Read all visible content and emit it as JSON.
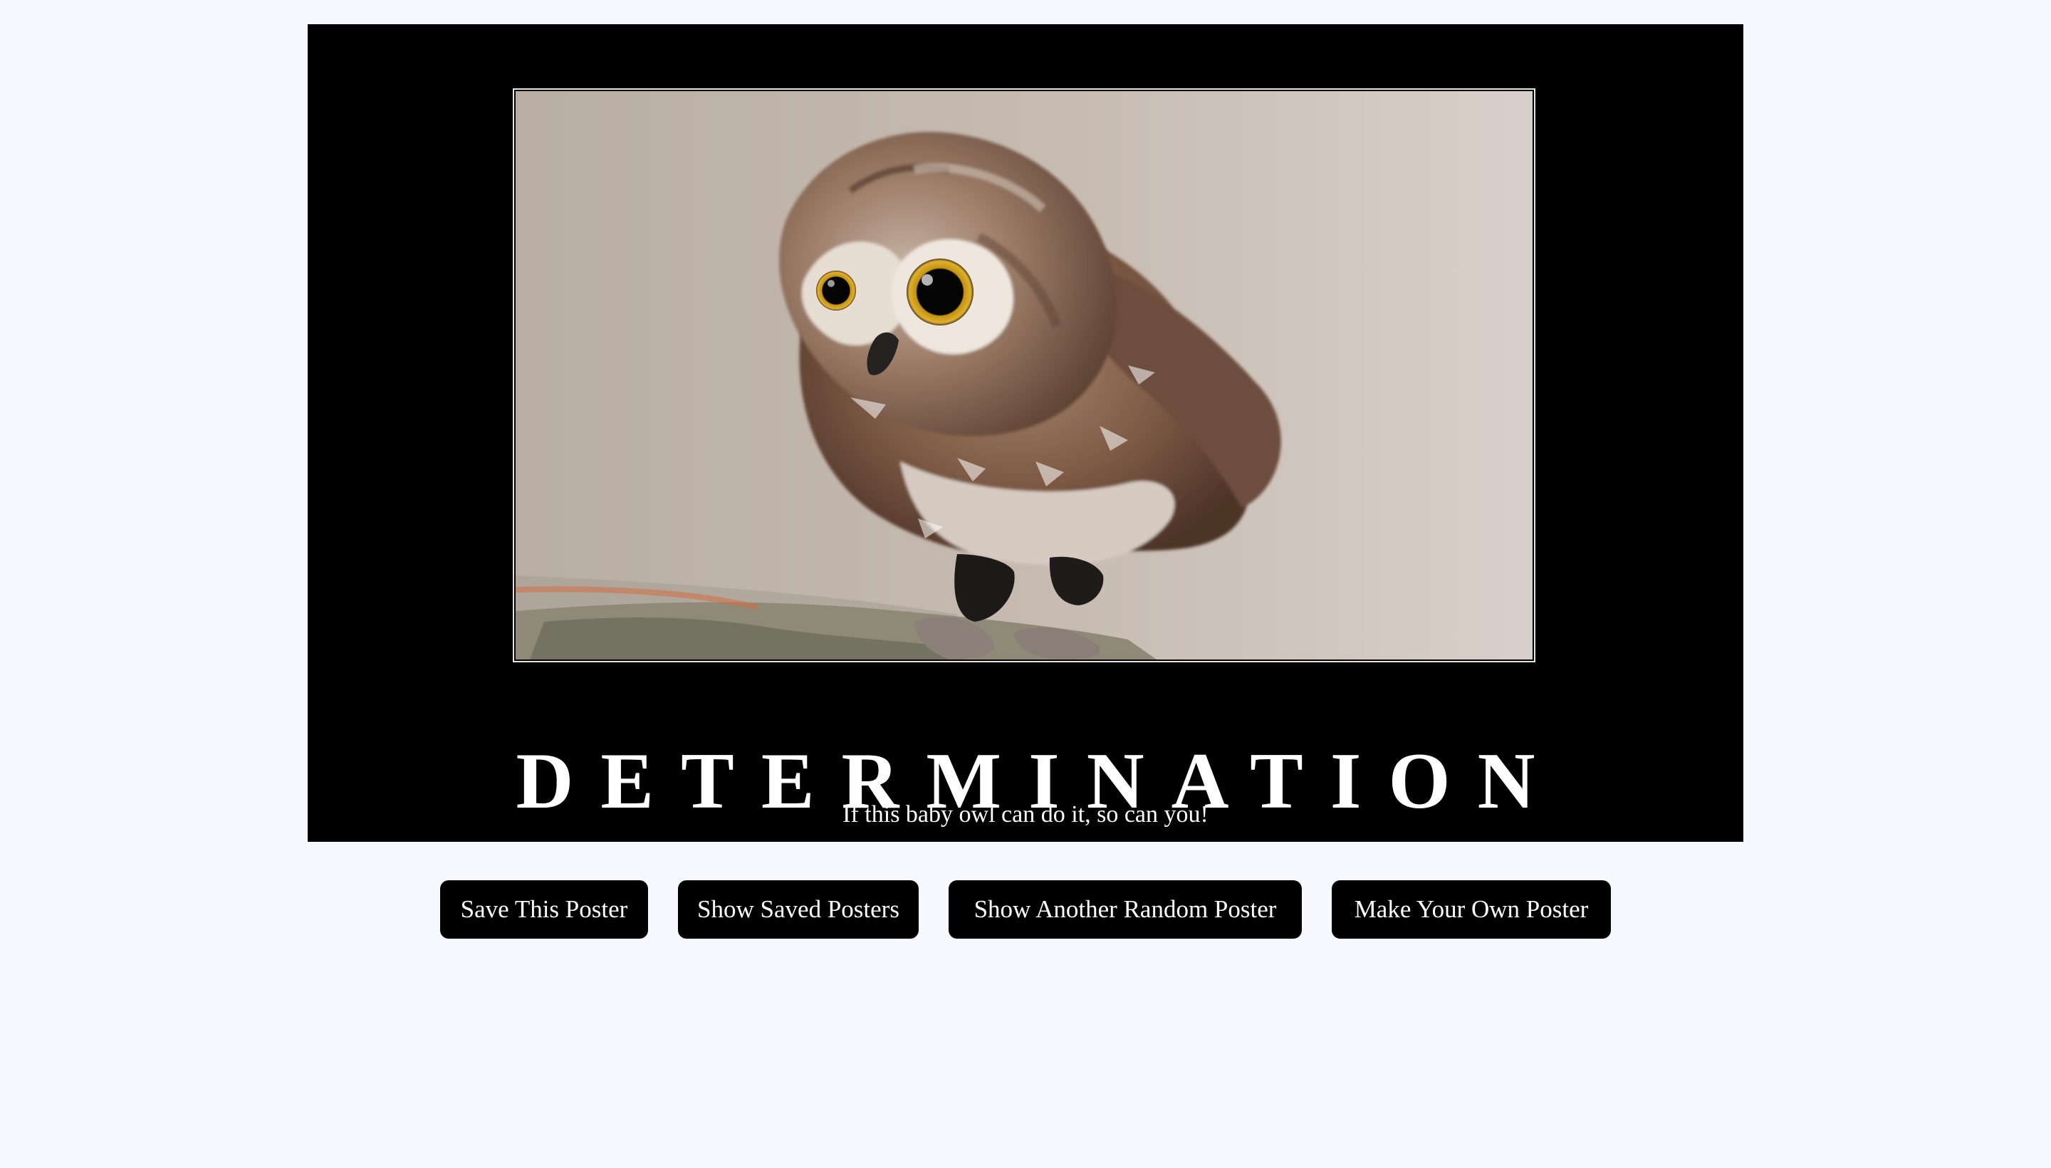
{
  "poster": {
    "title": "DETERMINATION",
    "quote": "If this baby owl can do it, so can you!",
    "image_icon": "owl-photo"
  },
  "buttons": {
    "save": "Save This Poster",
    "show_saved": "Show Saved Posters",
    "random": "Show Another Random Poster",
    "make_own": "Make Your Own Poster"
  },
  "colors": {
    "page_background": "#f8f8ff",
    "poster_background": "#000000",
    "button_background": "#000000",
    "button_text": "#ffffff",
    "poster_text": "#ffffff"
  }
}
